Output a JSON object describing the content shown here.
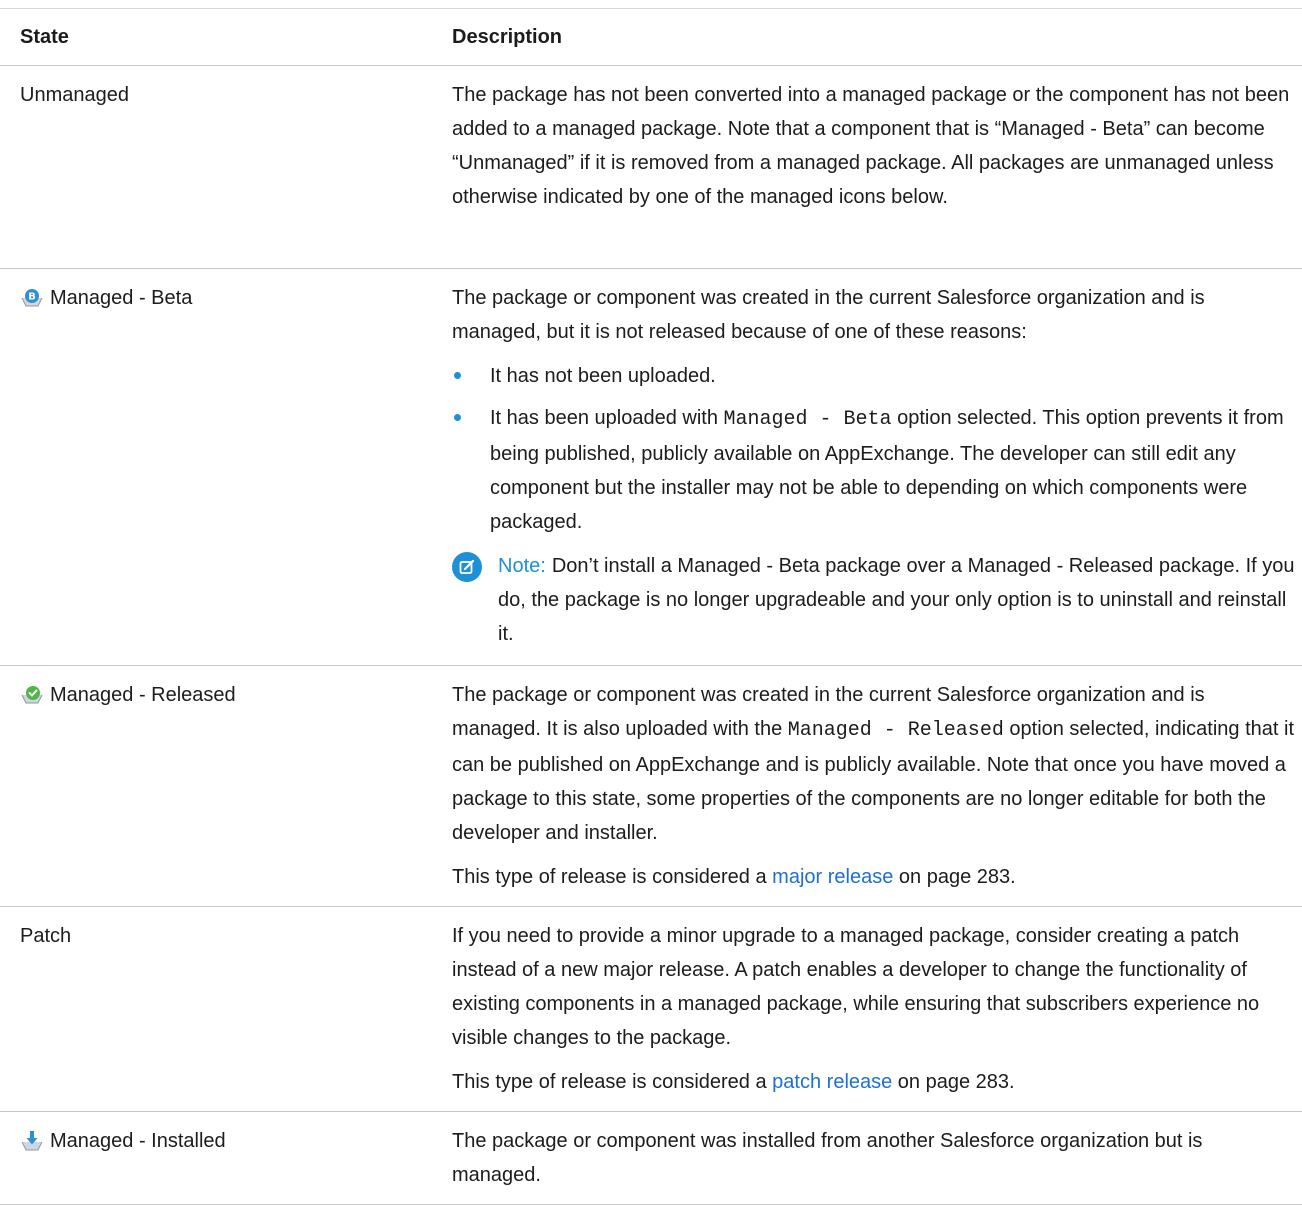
{
  "table": {
    "headers": {
      "state": "State",
      "description": "Description"
    },
    "rows": [
      {
        "state": "Unmanaged",
        "icon": "none",
        "paragraphs": [
          "The package has not been converted into a managed package or the component has not been added to a managed package. Note that a component that is “Managed - Beta” can become “Unmanaged” if it is removed from a managed package. All packages are unmanaged unless otherwise indicated by one of the managed icons below."
        ]
      },
      {
        "state": "Managed - Beta",
        "icon": "managed-beta-icon",
        "intro": "The package or component was created in the current Salesforce organization and is managed, but it is not released because of one of these reasons:",
        "bullets": {
          "b1": "It has not been uploaded.",
          "b2_pre": "It has been uploaded with ",
          "b2_code": "Managed - Beta",
          "b2_post": " option selected. This option prevents it from being published, publicly available on AppExchange. The developer can still edit any component but the installer may not be able to depending on which components were packaged."
        },
        "note": {
          "label": "Note:",
          "text": "Don’t install a Managed - Beta package over a Managed - Released package. If you do, the package is no longer upgradeable and your only option is to uninstall and reinstall it."
        }
      },
      {
        "state": "Managed - Released",
        "icon": "managed-released-icon",
        "p1_pre": "The package or component was created in the current Salesforce organization and is managed. It is also uploaded with the ",
        "p1_code": "Managed - Released",
        "p1_post": " option selected, indicating that it can be published on AppExchange and is publicly available. Note that once you have moved a package to this state, some properties of the components are no longer editable for both the developer and installer.",
        "p2_pre": "This type of release is considered a ",
        "p2_link": "major release",
        "p2_post": " on page 283."
      },
      {
        "state": "Patch",
        "icon": "none",
        "p1": "If you need to provide a minor upgrade to a managed package, consider creating a patch instead of a new major release. A patch enables a developer to change the functionality of existing components in a managed package, while ensuring that subscribers experience no visible changes to the package.",
        "p2_pre": "This type of release is considered a ",
        "p2_link": "patch release",
        "p2_post": " on page 283."
      },
      {
        "state": "Managed - Installed",
        "icon": "managed-installed-icon",
        "p1": "The package or component was installed from another Salesforce organization but is managed."
      }
    ]
  },
  "colors": {
    "link": "#1d6fd6",
    "note_accent": "#1d90d6",
    "rule": "#c6c6c6"
  }
}
